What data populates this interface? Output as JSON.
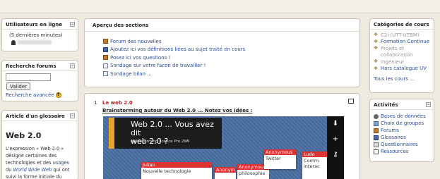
{
  "left": {
    "online": {
      "title": "Utilisateurs en ligne",
      "subtitle": "(5 dernières minutes)"
    },
    "search": {
      "title": "Recherche forums",
      "button": "Valider",
      "advanced": "Recherche avancée",
      "help": "?"
    },
    "glossary": {
      "title": "Article d'un glossaire",
      "entry_title": "Web 2.0",
      "line1": "L'expression « Web 2.0 »",
      "line2a": "désigne certaines des",
      "line3a": "technologies et des ",
      "line3b": "usages",
      "line4a": "du ",
      "line4b": "World Wide Web",
      "line4c": " qui ont",
      "line5": "suivi la forme initiale du"
    }
  },
  "center": {
    "overview": {
      "title": "Aperçu des sections",
      "items": [
        {
          "label": "Forum des nouvelles",
          "icon": "forum-icon"
        },
        {
          "label": "Ajoutez ici vos définitions liées au sujet traité en cours",
          "icon": "glossary-icon"
        },
        {
          "label": "Posez ici vos questions !",
          "icon": "forum-icon"
        },
        {
          "label": "Sondage sur votre facon de travailler !",
          "icon": "survey-icon"
        },
        {
          "label": "Sondage bilan ...",
          "icon": "survey-icon"
        }
      ]
    },
    "section1": {
      "number": "1",
      "title": "Le web 2.0",
      "subtitle": "Brainstorming autour du Web 2.0 ... Notez vos idées :"
    },
    "slide": {
      "title_line1": "Web 2.0 ... Vous avez dit",
      "title_line2": "web 2.0 ?",
      "caption": "brainstorming licence Pro 2IMI",
      "notes": [
        {
          "who": "Julian",
          "text": "Nouvelle technologie"
        },
        {
          "who": "Anonym",
          "text": ""
        },
        {
          "who": "Anonymous",
          "text": "philosophie"
        },
        {
          "who": "Anonymous",
          "text": "Twitter"
        },
        {
          "who": "Ludo",
          "text": "Comm interac"
        }
      ],
      "side_icons": [
        "arrow-down-icon",
        "plus-icon",
        "key-icon"
      ]
    }
  },
  "right": {
    "categories": {
      "title": "Catégories de cours",
      "items": [
        {
          "label": "C2i (UTT-UTBM)",
          "muted": true
        },
        {
          "label": "Formation Continue",
          "muted": false
        },
        {
          "label": "Projets et",
          "muted": true
        },
        {
          "label": "collaboration",
          "muted": true
        },
        {
          "label": "Ingénieur",
          "muted": true
        },
        {
          "label": "Hors catalogue UV",
          "muted": false
        }
      ],
      "all": "Tous les cours ..."
    },
    "activities": {
      "title": "Activités",
      "items": [
        {
          "label": "Bases de données",
          "icon": "database-icon"
        },
        {
          "label": "Choix de groupes",
          "icon": "choice-icon"
        },
        {
          "label": "Forums",
          "icon": "forum-icon"
        },
        {
          "label": "Glossaires",
          "icon": "glossary-icon"
        },
        {
          "label": "Questionnaires",
          "icon": "quiz-icon"
        },
        {
          "label": "Ressources",
          "icon": "resource-icon"
        }
      ]
    }
  },
  "colors": {
    "link": "#2a4d9a",
    "section_title": "#bb2222",
    "slide_accent": "#e8a52a"
  }
}
